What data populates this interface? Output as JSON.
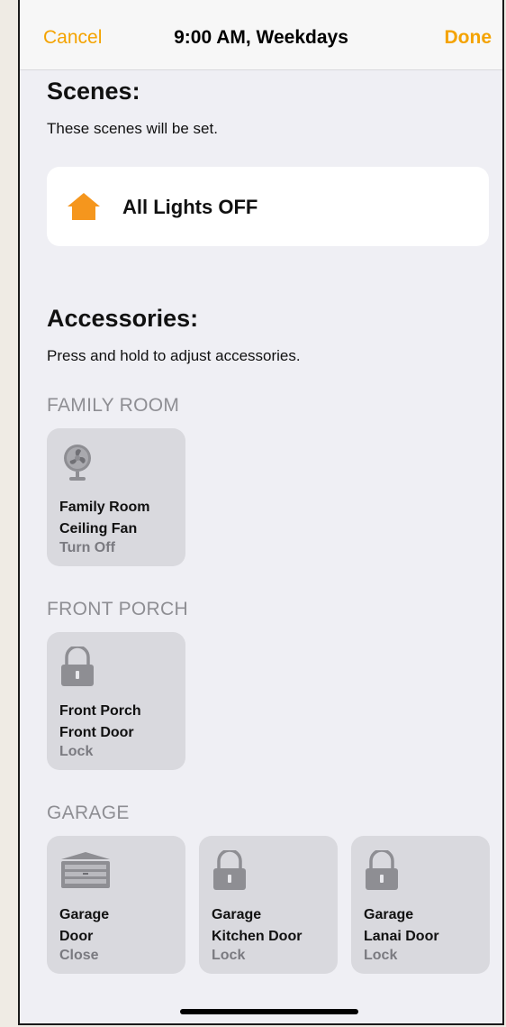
{
  "navbar": {
    "cancel": "Cancel",
    "title": "9:00 AM, Weekdays",
    "done": "Done"
  },
  "scenes": {
    "heading": "Scenes:",
    "subtitle": "These scenes will be set.",
    "items": [
      {
        "label": "All Lights OFF",
        "icon": "house-icon"
      }
    ]
  },
  "accessories": {
    "heading": "Accessories:",
    "subtitle": "Press and hold to adjust accessories.",
    "rooms": [
      {
        "name": "FAMILY ROOM",
        "tiles": [
          {
            "line1": "Family Room",
            "line2": "Ceiling Fan",
            "status": "Turn Off",
            "icon": "fan-icon"
          }
        ]
      },
      {
        "name": "FRONT PORCH",
        "tiles": [
          {
            "line1": "Front Porch",
            "line2": "Front Door",
            "status": "Lock",
            "icon": "lock-icon"
          }
        ]
      },
      {
        "name": "GARAGE",
        "tiles": [
          {
            "line1": "Garage",
            "line2": "Door",
            "status": "Close",
            "icon": "garage-door-icon"
          },
          {
            "line1": "Garage",
            "line2": "Kitchen Door",
            "status": "Lock",
            "icon": "lock-icon"
          },
          {
            "line1": "Garage",
            "line2": "Lanai Door",
            "status": "Lock",
            "icon": "lock-icon"
          }
        ]
      }
    ]
  },
  "colors": {
    "accent": "#f4a300",
    "background": "#efeff4",
    "tile": "#d9d9de",
    "card": "#ffffff"
  }
}
